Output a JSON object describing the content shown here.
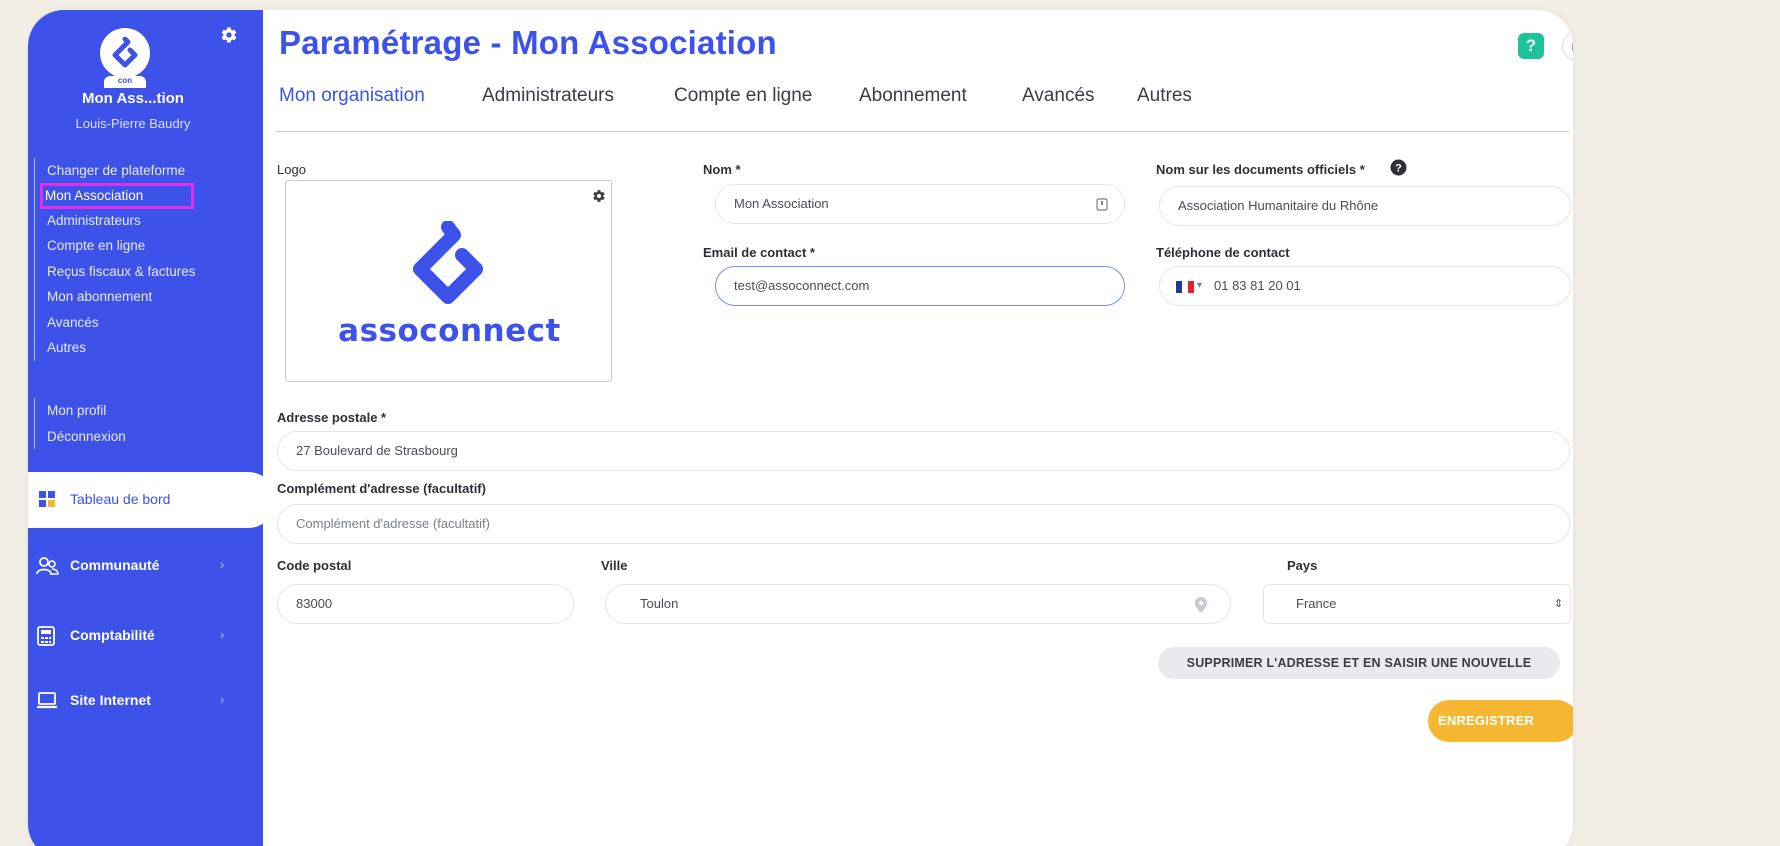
{
  "sidebar": {
    "org_short": "Mon Ass...tion",
    "user": "Louis-Pierre Baudry",
    "logo_caption": "con",
    "menu": [
      {
        "label": "Changer de plateforme"
      },
      {
        "label": "Mon Association",
        "active": true
      },
      {
        "label": "Administrateurs"
      },
      {
        "label": "Compte en ligne"
      },
      {
        "label": "Reçus fiscaux & factures"
      },
      {
        "label": "Mon abonnement"
      },
      {
        "label": "Avancés"
      },
      {
        "label": "Autres"
      }
    ],
    "menu2": [
      {
        "label": "Mon profil"
      },
      {
        "label": "Déconnexion"
      }
    ],
    "dashboard": "Tableau de bord",
    "nav": [
      {
        "label": "Communauté",
        "icon": "community-icon"
      },
      {
        "label": "Comptabilité",
        "icon": "calculator-icon"
      },
      {
        "label": "Site Internet",
        "icon": "laptop-icon"
      }
    ],
    "chevron": "›"
  },
  "header": {
    "title": "Paramétrage - Mon Association",
    "help": "?"
  },
  "tabs": [
    {
      "label": "Mon organisation",
      "active": true
    },
    {
      "label": "Administrateurs"
    },
    {
      "label": "Compte en ligne"
    },
    {
      "label": "Abonnement"
    },
    {
      "label": "Avancés"
    },
    {
      "label": "Autres"
    }
  ],
  "form": {
    "logo_label": "Logo",
    "logo_word": "assoconnect",
    "nom_label": "Nom *",
    "nom_value": "Mon Association",
    "official_label": "Nom sur les documents officiels *",
    "official_value": "Association Humanitaire du Rhône",
    "email_label": "Email de contact *",
    "email_value": "test@assoconnect.com",
    "phone_label": "Téléphone de contact",
    "phone_value": "01 83 81 20 01",
    "address_label": "Adresse postale *",
    "address_value": "27 Boulevard de Strasbourg",
    "complement_label": "Complément d'adresse (facultatif)",
    "complement_placeholder": "Complément d'adresse (facultatif)",
    "postal_label": "Code postal",
    "postal_value": "83000",
    "city_label": "Ville",
    "city_value": "Toulon",
    "country_label": "Pays",
    "country_value": "France"
  },
  "buttons": {
    "delete_address": "SUPPRIMER L'ADRESSE ET EN SAISIR UNE NOUVELLE",
    "save": "ENREGISTRER"
  },
  "colors": {
    "primary": "#3c52e8",
    "highlight": "#e22ee8",
    "help": "#1fc398",
    "save": "#f5b731"
  }
}
